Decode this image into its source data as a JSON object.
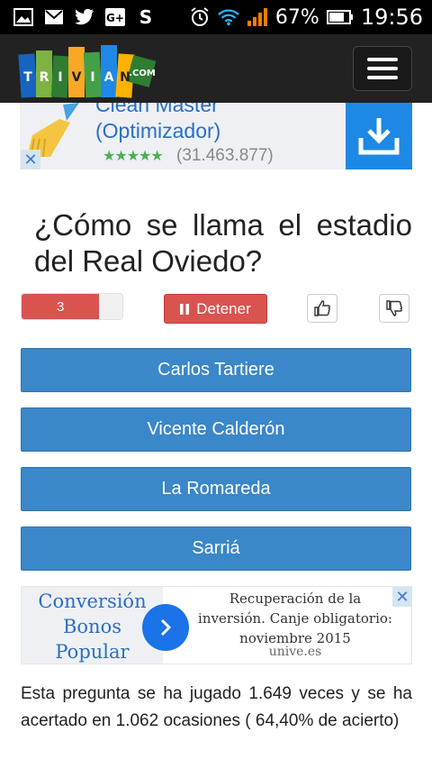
{
  "status_bar": {
    "battery": "67%",
    "time": "19:56"
  },
  "app": {
    "logo_text": "TRIVIANET.COM"
  },
  "ad_top": {
    "title": "Clean Master (Optimizador)",
    "stars": "★★★★★",
    "count": "(31.463.877)",
    "close": "✕"
  },
  "question": "¿Cómo se llama el estadio del Real Oviedo?",
  "controls": {
    "timer_value": "3",
    "timer_progress": 0.77,
    "stop_label": "Detener"
  },
  "answers": [
    "Carlos Tartiere",
    "Vicente Calderón",
    "La Romareda",
    "Sarriá"
  ],
  "ad_bottom": {
    "brand_line1": "Conversión",
    "brand_line2": "Bonos",
    "brand_line3": "Popular",
    "body": "Recuperación de la inversión. Canje obligatorio: noviembre 2015",
    "domain": "unive.es",
    "close": "✕"
  },
  "stats_text": "Esta pregunta se ha jugado 1.649 veces y se ha acertado en 1.062 ocasiones ( 64,40% de acierto)",
  "colors": {
    "answer_blue": "#3a87c9",
    "stop_red": "#d9534f",
    "ad_blue": "#1e88e5"
  }
}
